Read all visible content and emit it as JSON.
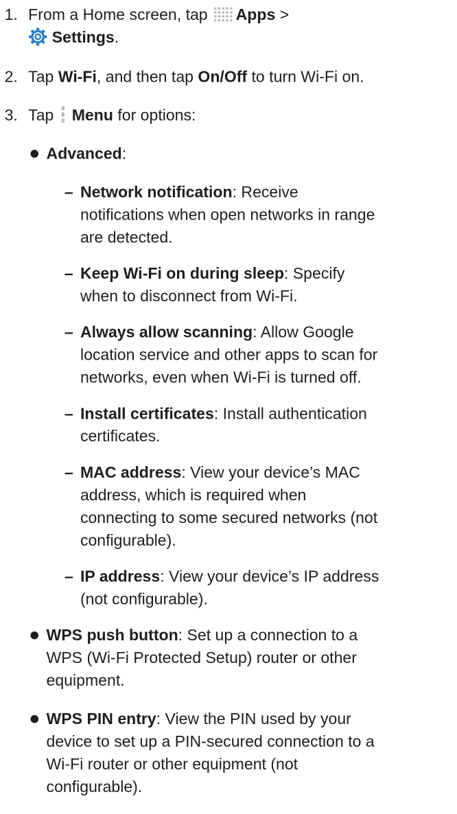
{
  "steps": [
    {
      "num": "1.",
      "pre": "From a Home screen, tap",
      "apps_label": "Apps",
      "separator": ">",
      "settings_label": "Settings",
      "end": "."
    },
    {
      "num": "2.",
      "pre": "Tap",
      "wifi_label": "Wi-Fi",
      "mid": ", and then tap",
      "onoff_label": "On/Off",
      "post": "to turn Wi-Fi on."
    },
    {
      "num": "3.",
      "pre": "Tap",
      "menu_label": "Menu",
      "post": "for options:"
    }
  ],
  "advanced": {
    "label": "Advanced",
    "suffix": ":"
  },
  "advanced_items": [
    {
      "term": "Network notification",
      "desc": ": Receive notifications when open networks in range are detected."
    },
    {
      "term": "Keep Wi-Fi on during sleep",
      "desc": ": Specify when to disconnect from Wi-Fi."
    },
    {
      "term": "Always allow scanning",
      "desc": ": Allow Google location service and other apps to scan for networks, even when Wi-Fi is turned off."
    },
    {
      "term": "Install certificates",
      "desc": ": Install authentication certificates."
    },
    {
      "term": "MAC address",
      "desc": ": View your device’s MAC address, which is required when connecting to some secured networks (not configurable)."
    },
    {
      "term": "IP address",
      "desc": ": View your device’s IP address (not configurable)."
    }
  ],
  "bullets": [
    {
      "term": "WPS push button",
      "desc": ": Set up a connection to a WPS (Wi-Fi Protected Setup) router or other equipment."
    },
    {
      "term": "WPS PIN entry",
      "desc": ": View the PIN used by your device to set up a PIN-secured connection to a Wi-Fi router or other equipment (not configurable)."
    }
  ],
  "icons": {
    "apps": "apps-grid-icon",
    "settings": "settings-gear-icon",
    "menu": "menu-dots-icon"
  },
  "colors": {
    "text": "#1e1e1e",
    "icon_gray": "#b9b9b9",
    "settings_blue": "#2f80c9"
  }
}
